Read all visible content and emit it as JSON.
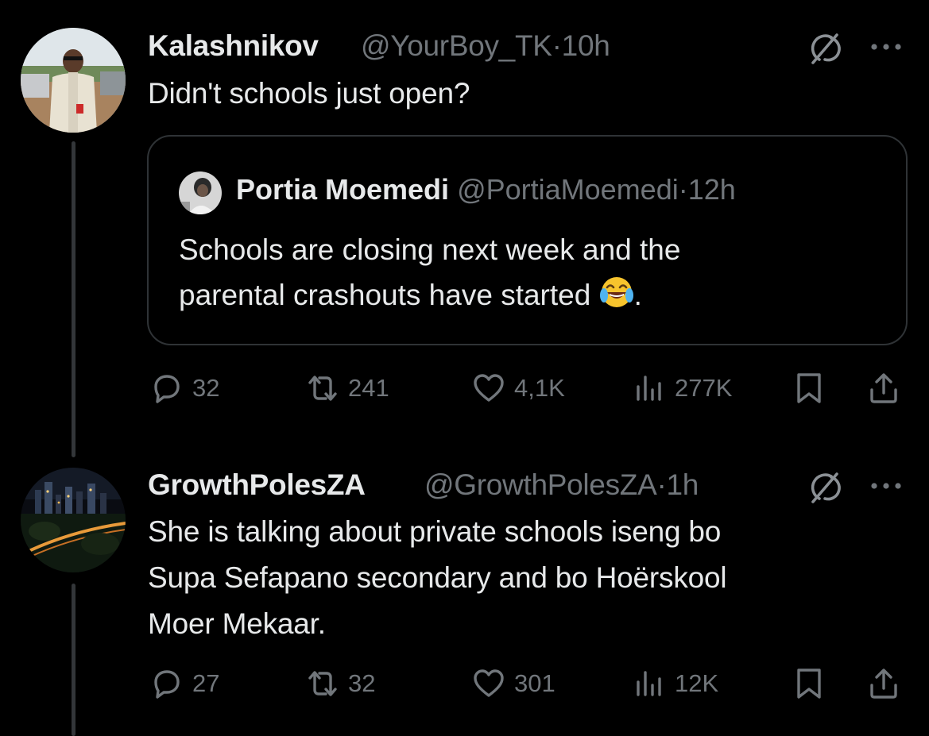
{
  "colors": {
    "background": "#000000",
    "text_primary": "#e7e9ea",
    "text_secondary": "#71767b",
    "border": "#2f3336"
  },
  "tweets": [
    {
      "display_name": "Kalashnikov",
      "handle": "@YourBoy_TK",
      "separator": "·",
      "time": "10h",
      "text": "Didn't schools just open?",
      "quote": {
        "display_name": "Portia Moemedi",
        "handle": "@PortiaMoemedi",
        "separator": "·",
        "time": "12h",
        "text_line1": "Schools are closing next week and the",
        "text_line2": "parental crashouts have started ",
        "text_after_emoji": ".",
        "emoji": "face-with-tears-of-joy"
      },
      "actions": {
        "replies": "32",
        "reposts": "241",
        "likes": "4,1K",
        "views": "277K"
      }
    },
    {
      "display_name": "GrowthPolesZA",
      "handle": "@GrowthPolesZA",
      "separator": "·",
      "time": "1h",
      "text_line1": "She is talking about private schools iseng bo",
      "text_line2": "Supa Sefapano secondary and bo Hoërskool",
      "text_line3": "Moer Mekaar.",
      "actions": {
        "replies": "27",
        "reposts": "32",
        "likes": "301",
        "views": "12K"
      }
    }
  ]
}
